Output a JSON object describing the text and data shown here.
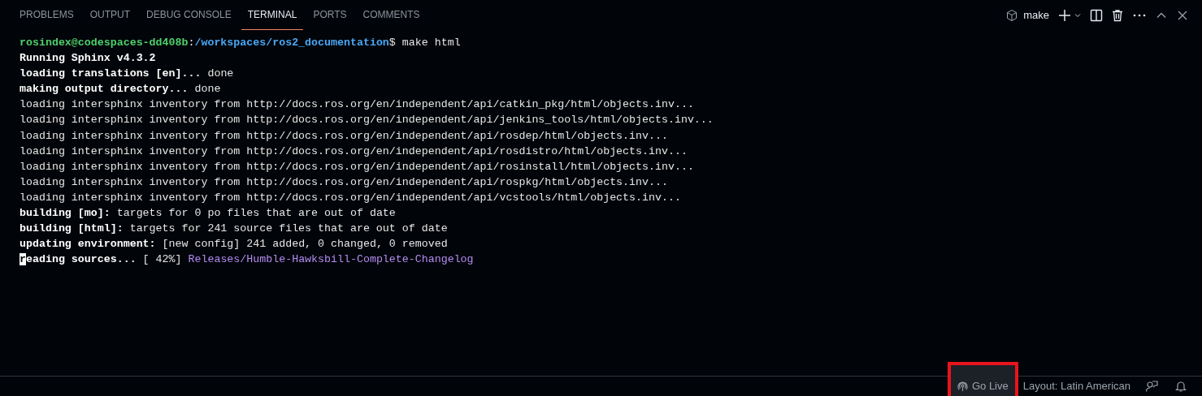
{
  "tabs": [
    {
      "label": "PROBLEMS",
      "selected": false
    },
    {
      "label": "OUTPUT",
      "selected": false
    },
    {
      "label": "DEBUG CONSOLE",
      "selected": false
    },
    {
      "label": "TERMINAL",
      "selected": true
    },
    {
      "label": "PORTS",
      "selected": false
    },
    {
      "label": "COMMENTS",
      "selected": false
    }
  ],
  "terminal_name": "make",
  "lines": [
    [
      {
        "kind": "user",
        "text": "rosindex@codespaces-dd408b"
      },
      {
        "kind": "plain",
        "text": ":"
      },
      {
        "kind": "path",
        "text": "/workspaces/ros2_documentation"
      },
      {
        "kind": "plain",
        "text": "$ make html"
      }
    ],
    [
      {
        "kind": "bold",
        "text": "Running Sphinx v4.3.2"
      }
    ],
    [
      {
        "kind": "bold",
        "text": "loading translations [en]..."
      },
      {
        "kind": "plain",
        "text": " done"
      }
    ],
    [
      {
        "kind": "bold",
        "text": "making output directory..."
      },
      {
        "kind": "plain",
        "text": " done"
      }
    ],
    [
      {
        "kind": "plain",
        "text": "loading intersphinx inventory from http://docs.ros.org/en/independent/api/catkin_pkg/html/objects.inv..."
      }
    ],
    [
      {
        "kind": "plain",
        "text": "loading intersphinx inventory from http://docs.ros.org/en/independent/api/jenkins_tools/html/objects.inv..."
      }
    ],
    [
      {
        "kind": "plain",
        "text": "loading intersphinx inventory from http://docs.ros.org/en/independent/api/rosdep/html/objects.inv..."
      }
    ],
    [
      {
        "kind": "plain",
        "text": "loading intersphinx inventory from http://docs.ros.org/en/independent/api/rosdistro/html/objects.inv..."
      }
    ],
    [
      {
        "kind": "plain",
        "text": "loading intersphinx inventory from http://docs.ros.org/en/independent/api/rosinstall/html/objects.inv..."
      }
    ],
    [
      {
        "kind": "plain",
        "text": "loading intersphinx inventory from http://docs.ros.org/en/independent/api/rospkg/html/objects.inv..."
      }
    ],
    [
      {
        "kind": "plain",
        "text": "loading intersphinx inventory from http://docs.ros.org/en/independent/api/vcstools/html/objects.inv..."
      }
    ],
    [
      {
        "kind": "bold",
        "text": "building [mo]:"
      },
      {
        "kind": "plain",
        "text": " targets for 0 po files that are out of date"
      }
    ],
    [
      {
        "kind": "bold",
        "text": "building [html]:"
      },
      {
        "kind": "plain",
        "text": " targets for 241 source files that are out of date"
      }
    ],
    [
      {
        "kind": "bold",
        "text": "updating environment:"
      },
      {
        "kind": "plain",
        "text": " [new config] 241 added, 0 changed, 0 removed"
      }
    ],
    [
      {
        "kind": "cursor",
        "text": "r"
      },
      {
        "kind": "bold",
        "text": "eading sources..."
      },
      {
        "kind": "plain",
        "text": " [ 42%] "
      },
      {
        "kind": "purple",
        "text": "Releases/Humble-Hawksbill-Complete-Changelog"
      }
    ]
  ],
  "status_bar": {
    "go_live": {
      "label": "Go Live",
      "highlighted": true
    },
    "layout": "Layout: Latin American"
  }
}
